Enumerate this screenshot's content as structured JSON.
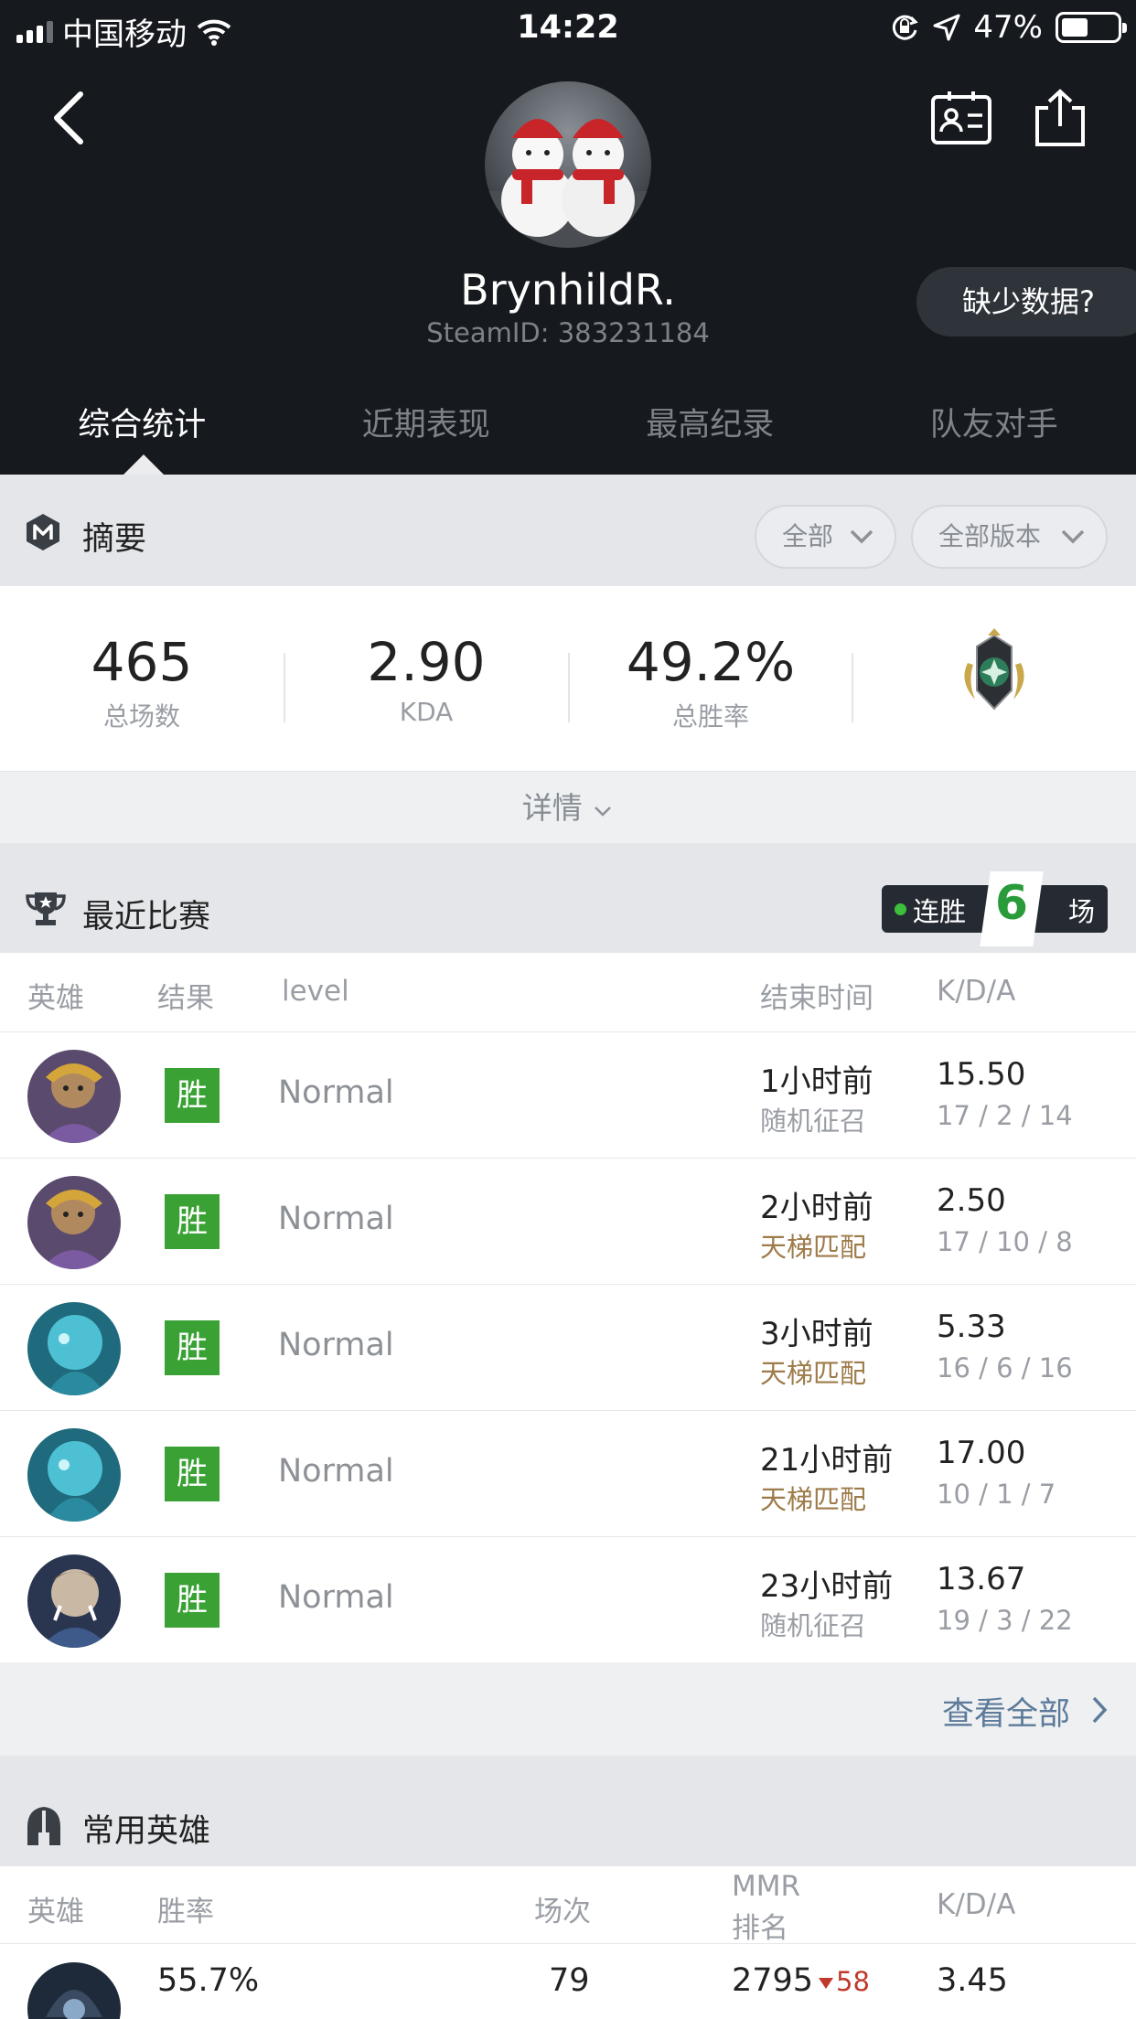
{
  "status_bar": {
    "carrier": "中国移动",
    "time": "14:22",
    "battery": "47%"
  },
  "profile": {
    "name": "BrynhildR.",
    "steam_id": "SteamID: 383231184",
    "missing_data": "缺少数据?"
  },
  "tabs": [
    "综合统计",
    "近期表现",
    "最高纪录",
    "队友对手"
  ],
  "summary": {
    "title": "摘要",
    "filter_all": "全部",
    "filter_version": "全部版本",
    "stats": [
      {
        "value": "465",
        "label": "总场数"
      },
      {
        "value": "2.90",
        "label": "KDA"
      },
      {
        "value": "49.2%",
        "label": "总胜率"
      }
    ],
    "details": "详情"
  },
  "recent": {
    "title": "最近比赛",
    "streak_prefix": "连胜",
    "streak_count": "6",
    "streak_suffix": "场",
    "headers": {
      "hero": "英雄",
      "result": "结果",
      "level": "level",
      "end_time": "结束时间",
      "kda": "K/D/A"
    },
    "matches": [
      {
        "result": "胜",
        "level": "Normal",
        "time": "1小时前",
        "mode": "随机征召",
        "kda": "15.50",
        "detail": "17 / 2 / 14"
      },
      {
        "result": "胜",
        "level": "Normal",
        "time": "2小时前",
        "mode": "天梯匹配",
        "kda": "2.50",
        "detail": "17 / 10 / 8"
      },
      {
        "result": "胜",
        "level": "Normal",
        "time": "3小时前",
        "mode": "天梯匹配",
        "kda": "5.33",
        "detail": "16 / 6 / 16"
      },
      {
        "result": "胜",
        "level": "Normal",
        "time": "21小时前",
        "mode": "天梯匹配",
        "kda": "17.00",
        "detail": "10 / 1 / 7"
      },
      {
        "result": "胜",
        "level": "Normal",
        "time": "23小时前",
        "mode": "随机征召",
        "kda": "13.67",
        "detail": "19 / 3 / 22"
      }
    ],
    "view_all": "查看全部"
  },
  "heroes": {
    "title": "常用英雄",
    "headers": {
      "hero": "英雄",
      "winrate": "胜率",
      "matches": "场次",
      "mmr_line1": "MMR",
      "mmr_line2": "排名",
      "kda": "K/D/A"
    },
    "rows": [
      {
        "winrate": "55.7%",
        "matches": "79",
        "mmr": "2795",
        "mmr_change": "58",
        "kda": "3.45"
      }
    ]
  },
  "colors": {
    "win_green": "#3aa234",
    "header_dark": "#161a1f",
    "mode_gold": "#9e7b4a",
    "link_blue": "#5c7a99"
  }
}
